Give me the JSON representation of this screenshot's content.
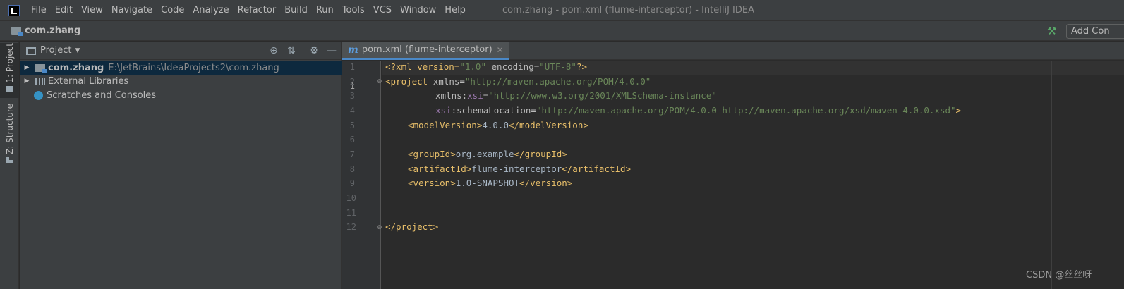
{
  "menubar": {
    "items": [
      "File",
      "Edit",
      "View",
      "Navigate",
      "Code",
      "Analyze",
      "Refactor",
      "Build",
      "Run",
      "Tools",
      "VCS",
      "Window",
      "Help"
    ],
    "window_title": "com.zhang - pom.xml (flume-interceptor) - IntelliJ IDEA"
  },
  "navbar": {
    "project": "com.zhang",
    "add_config": "Add Con"
  },
  "left_strip": {
    "project_tab": "1: Project",
    "structure_tab": "Z: Structure"
  },
  "project_panel": {
    "title": "Project",
    "tree": [
      {
        "name": "com.zhang",
        "path": "E:\\JetBrains\\IdeaProjects2\\com.zhang"
      },
      {
        "name": "External Libraries"
      },
      {
        "name": "Scratches and Consoles"
      }
    ]
  },
  "editor": {
    "tab_label": "pom.xml (flume-interceptor)",
    "line_numbers": [
      "1",
      "2",
      "3",
      "4",
      "5",
      "6",
      "7",
      "8",
      "9",
      "10",
      "11",
      "12"
    ],
    "code": {
      "l1": {
        "open": "<?xml version=",
        "v1": "\"1.0\"",
        "enc": " encoding=",
        "v2": "\"UTF-8\"",
        "close": "?>"
      },
      "l2": {
        "tag": "<project",
        "attr": " xmlns=",
        "val": "\"http://maven.apache.org/POM/4.0.0\""
      },
      "l3": {
        "pre": "xmlns:",
        "ns": "xsi",
        "eq": "=",
        "val": "\"http://www.w3.org/2001/XMLSchema-instance\""
      },
      "l4": {
        "ns": "xsi",
        "attr": ":schemaLocation=",
        "val": "\"http://maven.apache.org/POM/4.0.0 http://maven.apache.org/xsd/maven-4.0.0.xsd\"",
        "close": ">"
      },
      "l5": {
        "open": "<modelVersion>",
        "text": "4.0.0",
        "close": "</modelVersion>"
      },
      "l7": {
        "open": "<groupId>",
        "text": "org.example",
        "close": "</groupId>"
      },
      "l8": {
        "open": "<artifactId>",
        "text": "flume-interceptor",
        "close": "</artifactId>"
      },
      "l9": {
        "open": "<version>",
        "text": "1.0-SNAPSHOT",
        "close": "</version>"
      },
      "l12": {
        "close": "</project>"
      }
    }
  },
  "watermark": "CSDN @丝丝呀",
  "colors": {
    "tag": "#e8bf6a",
    "string": "#6a8759",
    "namespace": "#9876aa",
    "text": "#a9b7c6",
    "selection": "#0d293e",
    "accent": "#4a88c7"
  }
}
